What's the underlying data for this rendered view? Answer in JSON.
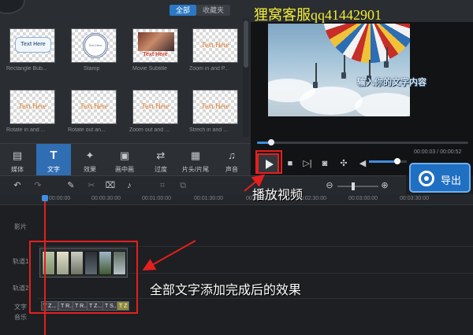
{
  "watermark": "狸窝客服qq41442901",
  "library": {
    "filter_tabs": [
      {
        "label": "全部",
        "active": true
      },
      {
        "label": "收藏夹",
        "active": false
      }
    ],
    "items": [
      {
        "name": "Rectangle Bub...",
        "sample": "Text Here",
        "style": "bubble"
      },
      {
        "name": "Stamp",
        "sample": "Text Here",
        "style": "stamp"
      },
      {
        "name": "Movie Subtitle",
        "sample": "Text Here",
        "style": "movie"
      },
      {
        "name": "Zoom in and P...",
        "sample": "Text Here",
        "style": "plain"
      },
      {
        "name": "Rotate in and ...",
        "sample": "Text Here",
        "style": "plain"
      },
      {
        "name": "Rotate out an...",
        "sample": "Text Here",
        "style": "plain"
      },
      {
        "name": "Zoom out and ...",
        "sample": "Text Here",
        "style": "plain"
      },
      {
        "name": "Strech in and ...",
        "sample": "Text Here",
        "style": "plain"
      }
    ]
  },
  "function_bar": [
    {
      "label": "媒体",
      "icon": "media-icon",
      "glyph": "▤",
      "active": false
    },
    {
      "label": "文字",
      "icon": "text-icon",
      "glyph": "T",
      "active": true
    },
    {
      "label": "效果",
      "icon": "effects-wand-icon",
      "glyph": "✦",
      "active": false
    },
    {
      "label": "画中画",
      "icon": "picture-in-picture-icon",
      "glyph": "▣",
      "active": false
    },
    {
      "label": "过度",
      "icon": "transition-icon",
      "glyph": "⇄",
      "active": false
    },
    {
      "label": "片头/片尾",
      "icon": "clapper-icon",
      "glyph": "▦",
      "active": false
    },
    {
      "label": "声音",
      "icon": "headphones-icon",
      "glyph": "♫",
      "active": false
    }
  ],
  "preview": {
    "overlay_text": "输入你的文字内容",
    "time": "00:00:03 / 00:00:52",
    "progress": 0.06,
    "volume": 0.7
  },
  "export": {
    "label": "导出"
  },
  "timeline": {
    "ruler": [
      "00:00:00",
      "00:00:30:00",
      "00:01:00:00",
      "00:01:30:00",
      "00:02:00:00",
      "00:02:30:00",
      "00:03:00:00",
      "00:03:30:00"
    ],
    "tracks": [
      "影片",
      "轨道1",
      "轨道2",
      "文字",
      "音乐"
    ],
    "text_chips": [
      "T Z...",
      "T R...",
      "T R...",
      "T Z...",
      "T S...",
      "T Z"
    ]
  },
  "annotations": {
    "play_video": "播放视频",
    "result_note": "全部文字添加完成后的效果"
  },
  "colors": {
    "accent": "#2f6eb3",
    "annotation_red": "#e41f1f",
    "watermark_yellow": "#f3ee36"
  }
}
